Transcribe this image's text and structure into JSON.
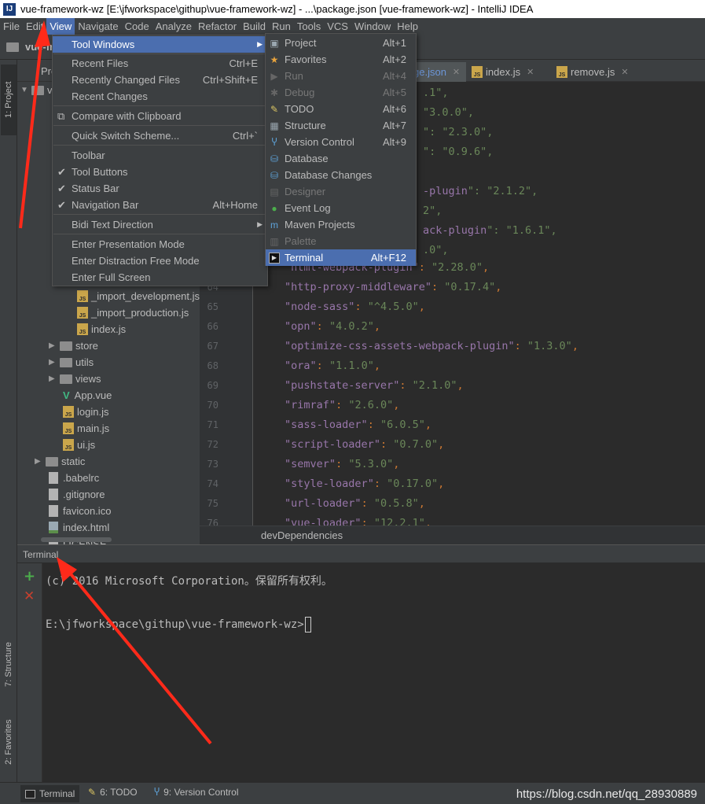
{
  "window": {
    "title": "vue-framework-wz [E:\\jfworkspace\\githup\\vue-framework-wz] - ...\\package.json [vue-framework-wz] - IntelliJ IDEA",
    "app_icon": "IJ"
  },
  "menubar": [
    "File",
    "Edit",
    "View",
    "Navigate",
    "Code",
    "Analyze",
    "Refactor",
    "Build",
    "Run",
    "Tools",
    "VCS",
    "Window",
    "Help"
  ],
  "active_menu": "View",
  "breadcrumb": "vue-fr",
  "left_tabs": {
    "project": "1: Project",
    "structure": "7: Structure",
    "favorites": "2: Favorites"
  },
  "view_menu": {
    "items": [
      {
        "label": "Tool Windows",
        "shortcut": "",
        "submenu": true,
        "highlight": true
      },
      {
        "label": "Recent Files",
        "shortcut": "Ctrl+E"
      },
      {
        "label": "Recently Changed Files",
        "shortcut": "Ctrl+Shift+E"
      },
      {
        "label": "Recent Changes",
        "shortcut": ""
      },
      {
        "label": "Compare with Clipboard",
        "shortcut": ""
      },
      {
        "label": "Quick Switch Scheme...",
        "shortcut": "Ctrl+`"
      },
      {
        "label": "Toolbar",
        "shortcut": ""
      },
      {
        "label": "Tool Buttons",
        "shortcut": "",
        "checked": true
      },
      {
        "label": "Status Bar",
        "shortcut": "",
        "checked": true
      },
      {
        "label": "Navigation Bar",
        "shortcut": "Alt+Home",
        "checked": true
      },
      {
        "label": "Bidi Text Direction",
        "shortcut": "",
        "submenu": true
      },
      {
        "label": "Enter Presentation Mode",
        "shortcut": ""
      },
      {
        "label": "Enter Distraction Free Mode",
        "shortcut": ""
      },
      {
        "label": "Enter Full Screen",
        "shortcut": ""
      }
    ]
  },
  "tool_windows_menu": {
    "items": [
      {
        "label": "Project",
        "shortcut": "Alt+1",
        "icon": "project-icon"
      },
      {
        "label": "Favorites",
        "shortcut": "Alt+2",
        "icon": "star-icon"
      },
      {
        "label": "Run",
        "shortcut": "Alt+4",
        "icon": "run-icon",
        "disabled": true
      },
      {
        "label": "Debug",
        "shortcut": "Alt+5",
        "icon": "debug-icon",
        "disabled": true
      },
      {
        "label": "TODO",
        "shortcut": "Alt+6",
        "icon": "todo-icon"
      },
      {
        "label": "Structure",
        "shortcut": "Alt+7",
        "icon": "structure-icon"
      },
      {
        "label": "Version Control",
        "shortcut": "Alt+9",
        "icon": "vcs-icon"
      },
      {
        "label": "Database",
        "shortcut": "",
        "icon": "database-icon"
      },
      {
        "label": "Database Changes",
        "shortcut": "",
        "icon": "database-changes-icon"
      },
      {
        "label": "Designer",
        "shortcut": "",
        "icon": "designer-icon",
        "disabled": true
      },
      {
        "label": "Event Log",
        "shortcut": "",
        "icon": "event-log-icon"
      },
      {
        "label": "Maven Projects",
        "shortcut": "",
        "icon": "maven-icon"
      },
      {
        "label": "Palette",
        "shortcut": "",
        "icon": "palette-icon",
        "disabled": true
      },
      {
        "label": "Terminal",
        "shortcut": "Alt+F12",
        "icon": "terminal-icon",
        "highlight": true
      }
    ]
  },
  "project_tree": [
    {
      "label": "_import_development.js",
      "type": "js"
    },
    {
      "label": "_import_production.js",
      "type": "js"
    },
    {
      "label": "index.js",
      "type": "js"
    },
    {
      "label": "store",
      "type": "folder"
    },
    {
      "label": "utils",
      "type": "folder"
    },
    {
      "label": "views",
      "type": "folder"
    },
    {
      "label": "App.vue",
      "type": "vue"
    },
    {
      "label": "login.js",
      "type": "js"
    },
    {
      "label": "main.js",
      "type": "js"
    },
    {
      "label": "ui.js",
      "type": "js"
    },
    {
      "label": "static",
      "type": "folder"
    },
    {
      "label": ".babelrc",
      "type": "file"
    },
    {
      "label": ".gitignore",
      "type": "file"
    },
    {
      "label": "favicon.ico",
      "type": "file"
    },
    {
      "label": "index.html",
      "type": "html"
    },
    {
      "label": "LICENSE",
      "type": "file"
    }
  ],
  "project_header_fragment": "Pro",
  "project_tree_root_fragment": "vu",
  "editor_tabs": [
    {
      "label": "ge.json",
      "active": true
    },
    {
      "label": "index.js"
    },
    {
      "label": "remove.js"
    }
  ],
  "code_fragments": [
    {
      "pre": "",
      "text": ".1\",",
      "kind": "v"
    },
    {
      "pre": "",
      "text": "\"3.0.0\",",
      "kind": "v"
    },
    {
      "pre": "",
      "text": "\": \"2.3.0\",",
      "kind": "v"
    },
    {
      "pre": "",
      "text": "\": \"0.9.6\",",
      "kind": "v"
    },
    {
      "pre": "",
      "text": "",
      "kind": "v"
    },
    {
      "pre": "-plugin",
      "text": "\": \"2.1.2\",",
      "kind": "k"
    },
    {
      "pre": "",
      "text": "2\",",
      "kind": "v"
    },
    {
      "pre": "ack-plugin",
      "text": "\": \"1.6.1\",",
      "kind": "k"
    },
    {
      "pre": "",
      "text": ".0\",",
      "kind": "v"
    }
  ],
  "code_lines": [
    {
      "num": "",
      "key": "html-webpack-plugin",
      "value": "2.28.0"
    },
    {
      "num": "64",
      "key": "http-proxy-middleware",
      "value": "0.17.4"
    },
    {
      "num": "65",
      "key": "node-sass",
      "value": "^4.5.0"
    },
    {
      "num": "66",
      "key": "opn",
      "value": "4.0.2"
    },
    {
      "num": "67",
      "key": "optimize-css-assets-webpack-plugin",
      "value": "1.3.0"
    },
    {
      "num": "68",
      "key": "ora",
      "value": "1.1.0"
    },
    {
      "num": "69",
      "key": "pushstate-server",
      "value": "2.1.0"
    },
    {
      "num": "70",
      "key": "rimraf",
      "value": "2.6.0"
    },
    {
      "num": "71",
      "key": "sass-loader",
      "value": "6.0.5"
    },
    {
      "num": "72",
      "key": "script-loader",
      "value": "0.7.0"
    },
    {
      "num": "73",
      "key": "semver",
      "value": "5.3.0"
    },
    {
      "num": "74",
      "key": "style-loader",
      "value": "0.17.0"
    },
    {
      "num": "75",
      "key": "url-loader",
      "value": "0.5.8"
    },
    {
      "num": "76",
      "key": "vue-loader",
      "value": "12.2.1"
    }
  ],
  "editor_breadcrumb": "devDependencies",
  "terminal": {
    "title": "Terminal",
    "line1": "(c) 2016 Microsoft Corporation。保留所有权利。",
    "prompt": "E:\\jfworkspace\\githup\\vue-framework-wz>"
  },
  "bottom_tools": [
    {
      "label": "Terminal",
      "icon": "terminal-icon",
      "active": true
    },
    {
      "label": "6: TODO",
      "icon": "todo-icon"
    },
    {
      "label": "9: Version Control",
      "icon": "vcs-icon"
    }
  ],
  "watermark": "https://blog.csdn.net/qq_28930889",
  "colors": {
    "accent": "#4b6eaf",
    "annotation_arrow": "#ff2a1a"
  }
}
